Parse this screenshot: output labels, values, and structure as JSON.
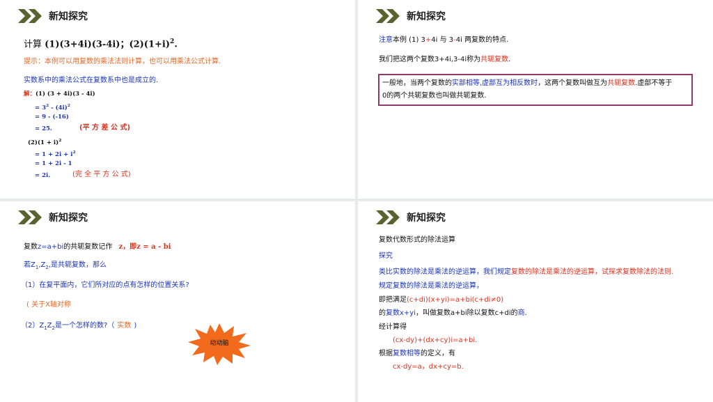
{
  "header_title": "新知探究",
  "slide1": {
    "calc_label": "计算",
    "calc_expr": "(1)(3+4i)(3-4i)；(2)(1+i)",
    "calc_sup": "2",
    "calc_end": ".",
    "hint": "提示：本例可以用复数的乘法法则计算，也可以用乘法公式计算.",
    "note": "实数系中的乘法公式在复数系中也是成立的.",
    "solution_label": "解：",
    "lines": {
      "l1": "(1) (3 + 4i)(3 - 4i)",
      "l2a": "= 3",
      "l2sup1": "2",
      "l2b": " - (4i)",
      "l2sup2": "2",
      "l3": "= 9 - (-16)",
      "l4": "= 25.",
      "l4_note": "(平 方 差 公 式)",
      "l5a": "(2)(1 + i)",
      "l5sup": "2",
      "l6a": "= 1 + 2i + i",
      "l6sup": "2",
      "l7": "= 1 + 2i - 1",
      "l8": "= 2i.",
      "l8_note": "(完 全 平 方 公 式)"
    }
  },
  "slide2": {
    "line1_a": "注意",
    "line1_b": "本例 (1) 3",
    "line1_c": "+",
    "line1_d": "4i 与 3",
    "line1_e": "-",
    "line1_f": "4i 两复数的特点.",
    "line2_a": "我们把这两个复数3+4i,3-4i称为",
    "line2_b": "共轭复数",
    "line2_c": ".",
    "box_a": "一般地，当两个复数的",
    "box_b": "实部相等,虚部互为相反数时",
    "box_c": "，这两个复数叫做互为",
    "box_d": "共轭复数",
    "box_e": ".虚部不等于",
    "box_line2": "0的两个共轭复数也叫做共轭复数."
  },
  "slide3": {
    "l1_a": "复数",
    "l1_b": "z=a+bi",
    "l1_c": "的共轭复数记作",
    "l1_d": "z，即z = a - bi",
    "l2_a": "若Z",
    "l2_sub1": "1",
    "l2_b": ",Z",
    "l2_sub2": "2",
    "l2_c": ",是共轭复数，那么",
    "q1": "（1）在复平面内，它们所对应的点有怎样的位置关系?",
    "a1": "( 关于X轴对称",
    "q2_a": "（2）Z",
    "q2_sub1": "1",
    "q2_b": "Z",
    "q2_sub2": "2",
    "q2_c": "是一个怎样的数?（",
    "a2": "实数",
    "q2_end": ")",
    "burst_label": "动动脑",
    "burst_color": "#f26a1b"
  },
  "slide4": {
    "title": "复数代数形式的除法运算",
    "explore": "探究",
    "l3_a": "类比实数的除法是乘法的逆运算，我们规定",
    "l3_b": "复数的除法是乘法的逆运算，试探求复数除法的法则.",
    "l4": "规定复数的除法是乘法的逆运算，",
    "l5_a": "即把满足",
    "l5_b": "(c+di)(x+yi)=a+bi(c+di≠0)",
    "l6_a": "的",
    "l6_b": "复数x+yi",
    "l6_c": "，叫做复数a+bi除以复数c+di的",
    "l6_d": "商",
    "l6_e": ".",
    "l7": "经计算得",
    "l8": "(cx-dy)+(dx+cy)i=a+bi.",
    "l9_a": "根据",
    "l9_b": "复数相等",
    "l9_c": "的定义，有",
    "l10": "cx-dy=a，dx+cy=b."
  },
  "colors": {
    "chevron": "#5a6330",
    "accent_blue": "#1a35b8",
    "accent_red": "#d8321e",
    "box_border": "#8d3a6b"
  }
}
